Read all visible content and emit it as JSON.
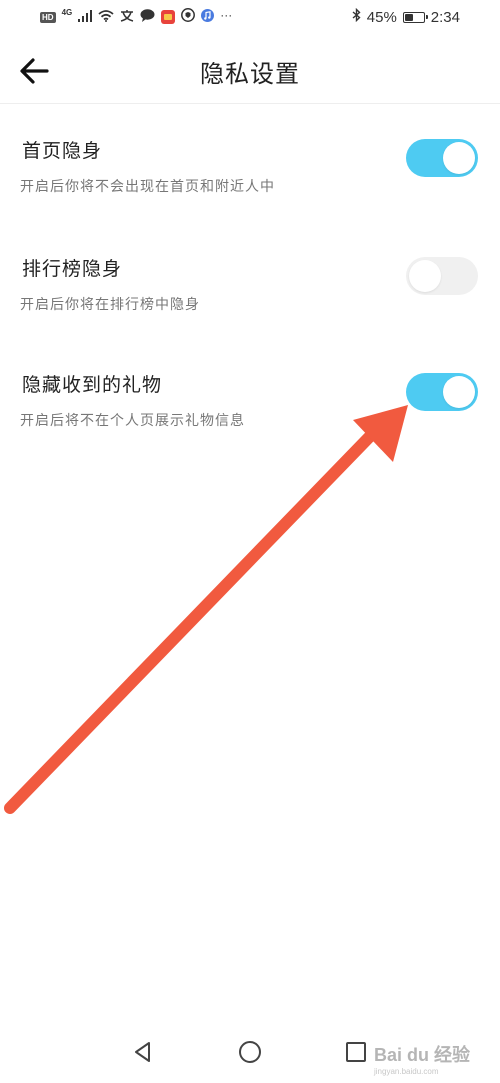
{
  "status_bar": {
    "network": "4G",
    "hd_label": "HD",
    "overflow": "···",
    "battery_percent": "45%",
    "battery_level": 0.45,
    "time": "2:34"
  },
  "header": {
    "back_icon": "arrow-left-icon",
    "title": "隐私设置"
  },
  "settings": [
    {
      "title": "首页隐身",
      "description": "开启后你将不会出现在首页和附近人中",
      "enabled": true
    },
    {
      "title": "排行榜隐身",
      "description": "开启后你将在排行榜中隐身",
      "enabled": false
    },
    {
      "title": "隐藏收到的礼物",
      "description": "开启后将不在个人页展示礼物信息",
      "enabled": true
    }
  ],
  "colors": {
    "toggle_on": "#4ecbf2",
    "toggle_off": "#f0f0f0",
    "annotation_arrow": "#f15a3f"
  },
  "nav_bar": {
    "icons": [
      "back-triangle-icon",
      "home-circle-icon",
      "recents-square-icon"
    ]
  },
  "watermark": {
    "text": "Bai du 经验",
    "subtext": "jingyan.baidu.com"
  }
}
